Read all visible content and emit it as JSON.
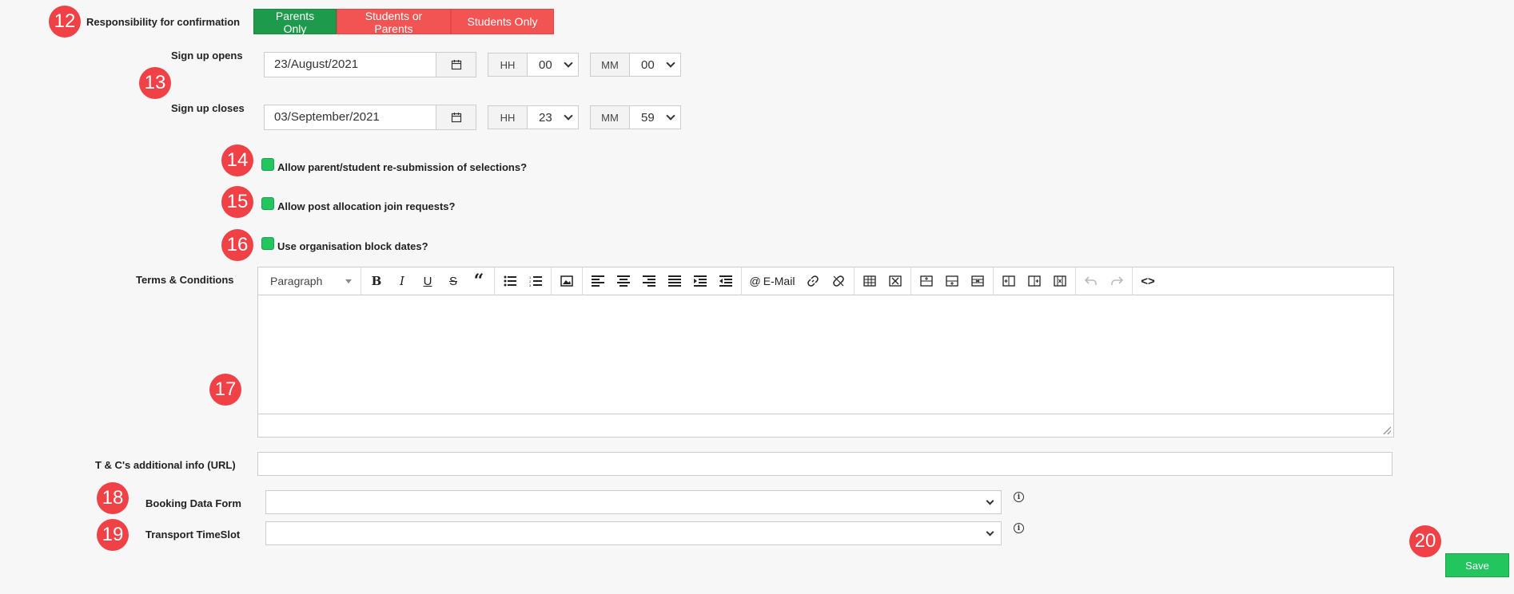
{
  "badges": {
    "b12": "12",
    "b13": "13",
    "b14": "14",
    "b15": "15",
    "b16": "16",
    "b17": "17",
    "b18": "18",
    "b19": "19",
    "b20": "20"
  },
  "confirmation": {
    "label": "Responsibility for confirmation",
    "options": [
      "Parents Only",
      "Students or Parents",
      "Students Only"
    ],
    "selected": "Parents Only"
  },
  "signup_opens": {
    "label": "Sign up opens",
    "date": "23/August/2021",
    "hh_label": "HH",
    "hh": "00",
    "mm_label": "MM",
    "mm": "00"
  },
  "signup_closes": {
    "label": "Sign up closes",
    "date": "03/September/2021",
    "hh_label": "HH",
    "hh": "23",
    "mm_label": "MM",
    "mm": "59"
  },
  "checkboxes": {
    "resubmission": {
      "label": "Allow parent/student re-submission of selections?",
      "checked": true
    },
    "post_allocation": {
      "label": "Allow post allocation join requests?",
      "checked": true
    },
    "block_dates": {
      "label": "Use organisation block dates?",
      "checked": true
    }
  },
  "terms": {
    "label": "Terms & Conditions",
    "toolbar": {
      "paragraph": "Paragraph",
      "email": "E-Mail"
    }
  },
  "tc_url": {
    "label": "T & C's additional info (URL)",
    "value": ""
  },
  "booking_form": {
    "label": "Booking Data Form",
    "value": ""
  },
  "transport": {
    "label": "Transport TimeSlot",
    "value": ""
  },
  "save": {
    "label": "Save"
  },
  "colors": {
    "active": "#1e9a4c",
    "inactive": "#f25454",
    "badge": "#ef4146",
    "checkbox": "#22c55e",
    "save": "#22c55e"
  }
}
